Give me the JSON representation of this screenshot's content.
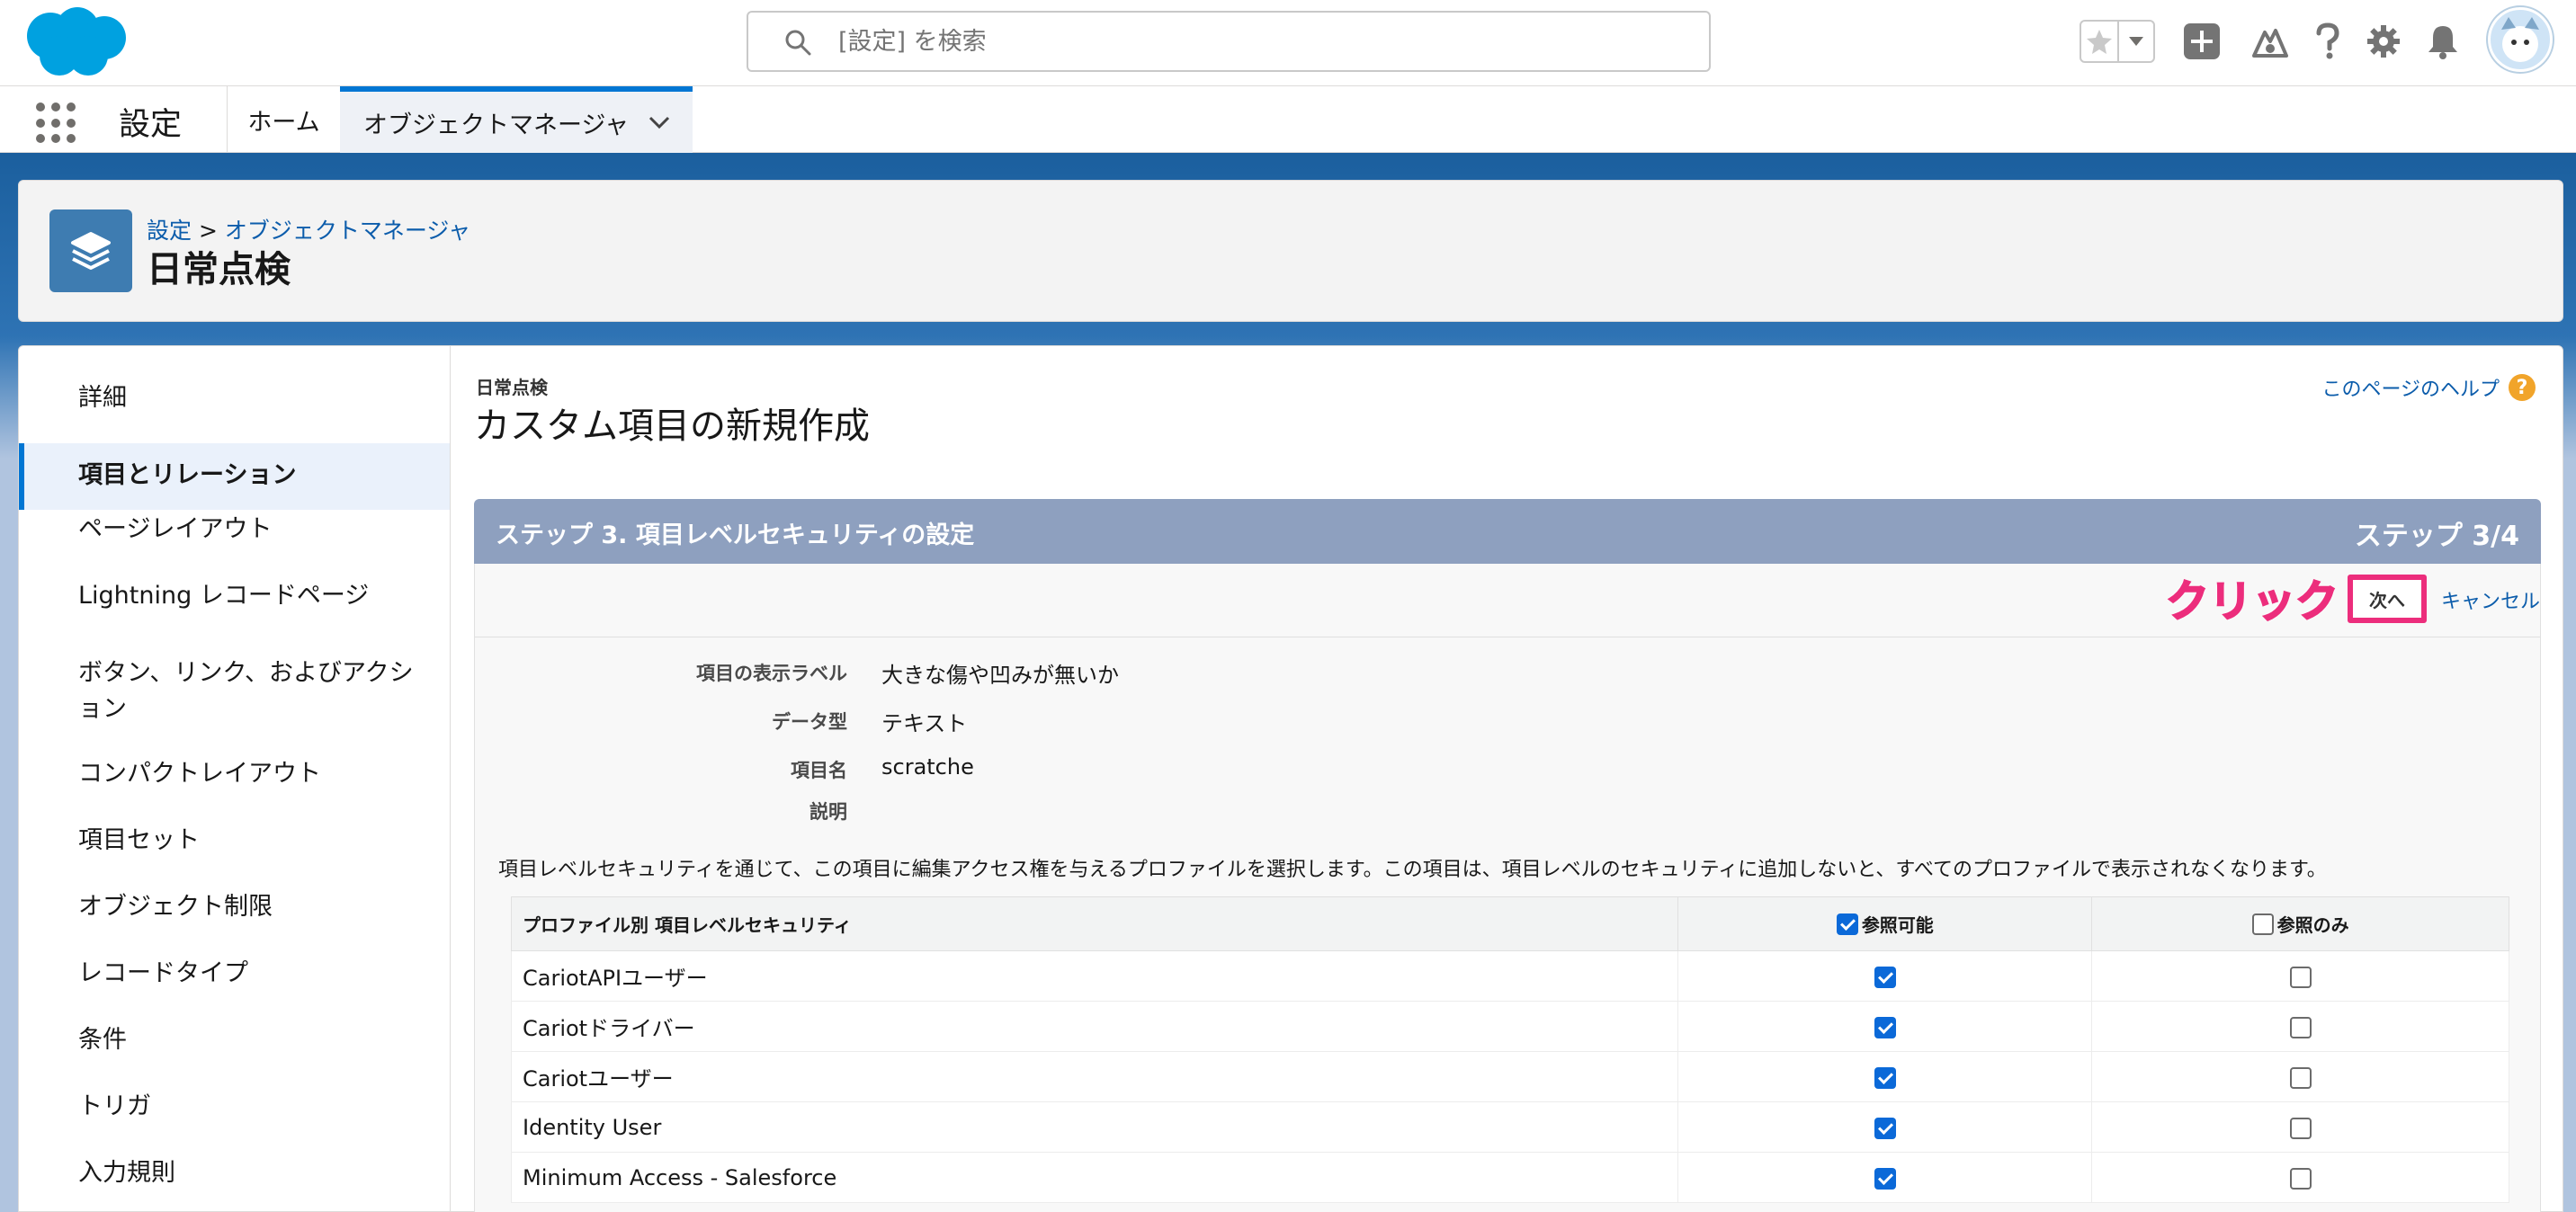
{
  "search": {
    "placeholder": "[設定] を検索"
  },
  "nav": {
    "app_name": "設定",
    "tabs": [
      {
        "label": "ホーム"
      },
      {
        "label": "オブジェクトマネージャ"
      }
    ]
  },
  "page_header": {
    "breadcrumb_root": "設定",
    "breadcrumb_sep": " > ",
    "breadcrumb_link": "オブジェクトマネージャ",
    "title": "日常点検"
  },
  "sidebar": {
    "items": [
      {
        "label": "詳細"
      },
      {
        "label": "項目とリレーション"
      },
      {
        "label": "ページレイアウト"
      },
      {
        "label": "Lightning レコードページ"
      },
      {
        "label": "ボタン、リンク、およびアクション"
      },
      {
        "label": "コンパクトレイアウト"
      },
      {
        "label": "項目セット"
      },
      {
        "label": "オブジェクト制限"
      },
      {
        "label": "レコードタイプ"
      },
      {
        "label": "条件"
      },
      {
        "label": "トリガ"
      },
      {
        "label": "入力規則"
      }
    ]
  },
  "content": {
    "subtitle": "日常点検",
    "title": "カスタム項目の新規作成",
    "help_link": "このページのヘルプ",
    "step_title": "ステップ 3. 項目レベルセキュリティの設定",
    "step_counter": "ステップ 3/4",
    "annotation": "クリック",
    "next_button": "次へ",
    "cancel_link": "キャンセル",
    "details": [
      {
        "label": "項目の表示ラベル",
        "value": "大きな傷や凹みが無いか"
      },
      {
        "label": "データ型",
        "value": "テキスト"
      },
      {
        "label": "項目名",
        "value": "scratche"
      },
      {
        "label": "説明",
        "value": ""
      }
    ],
    "instruction": "項目レベルセキュリティを通じて、この項目に編集アクセス権を与えるプロファイルを選択します。この項目は、項目レベルのセキュリティに追加しないと、すべてのプロファイルで表示されなくなります。",
    "table": {
      "headers": {
        "profile": "プロファイル別 項目レベルセキュリティ",
        "visible": "参照可能",
        "readonly": "参照のみ"
      },
      "header_visible_checked": true,
      "header_readonly_checked": false,
      "rows": [
        {
          "profile": "CariotAPIユーザー",
          "visible": true,
          "readonly": false
        },
        {
          "profile": "Cariotドライバー",
          "visible": true,
          "readonly": false
        },
        {
          "profile": "Cariotユーザー",
          "visible": true,
          "readonly": false
        },
        {
          "profile": "Identity User",
          "visible": true,
          "readonly": false
        },
        {
          "profile": "Minimum Access - Salesforce",
          "visible": true,
          "readonly": false
        }
      ]
    }
  },
  "colors": {
    "brand": "#0176d3",
    "step_header": "#8ea0bf",
    "annotation": "#ec2d7c",
    "link": "#0b5cab"
  },
  "icons": [
    "salesforce-cloud-logo",
    "search-icon",
    "star-icon",
    "chevron-down-icon",
    "plus-icon",
    "trailhead-icon",
    "help-icon",
    "gear-icon",
    "bell-icon",
    "avatar",
    "app-launcher-icon",
    "layers-icon"
  ]
}
